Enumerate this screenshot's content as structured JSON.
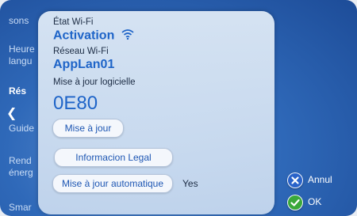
{
  "menu": {
    "items": [
      {
        "label": "sons"
      },
      {
        "label": "Heure"
      },
      {
        "label": "langu"
      },
      {
        "label": "Rés"
      },
      {
        "label": "Guide"
      },
      {
        "label": "Rend"
      },
      {
        "label": "énerg"
      },
      {
        "label": "Smar"
      }
    ]
  },
  "wifi_status": {
    "label": "État Wi-Fi",
    "value": "Activation"
  },
  "wifi_network": {
    "label": "Réseau Wi-Fi",
    "value": "AppLan01"
  },
  "software": {
    "label": "Mise à jour logicielle",
    "version": "0E80"
  },
  "buttons": {
    "update": "Mise à jour",
    "legal": "Informacion Legal",
    "auto_update": "Mise à jour automatique"
  },
  "auto_update_value": "Yes",
  "actions": {
    "cancel": "Annul",
    "ok": "OK"
  },
  "colors": {
    "accent": "#1e64c8",
    "ok_green": "#3aa83a",
    "cancel_blue": "#2a63c9"
  }
}
